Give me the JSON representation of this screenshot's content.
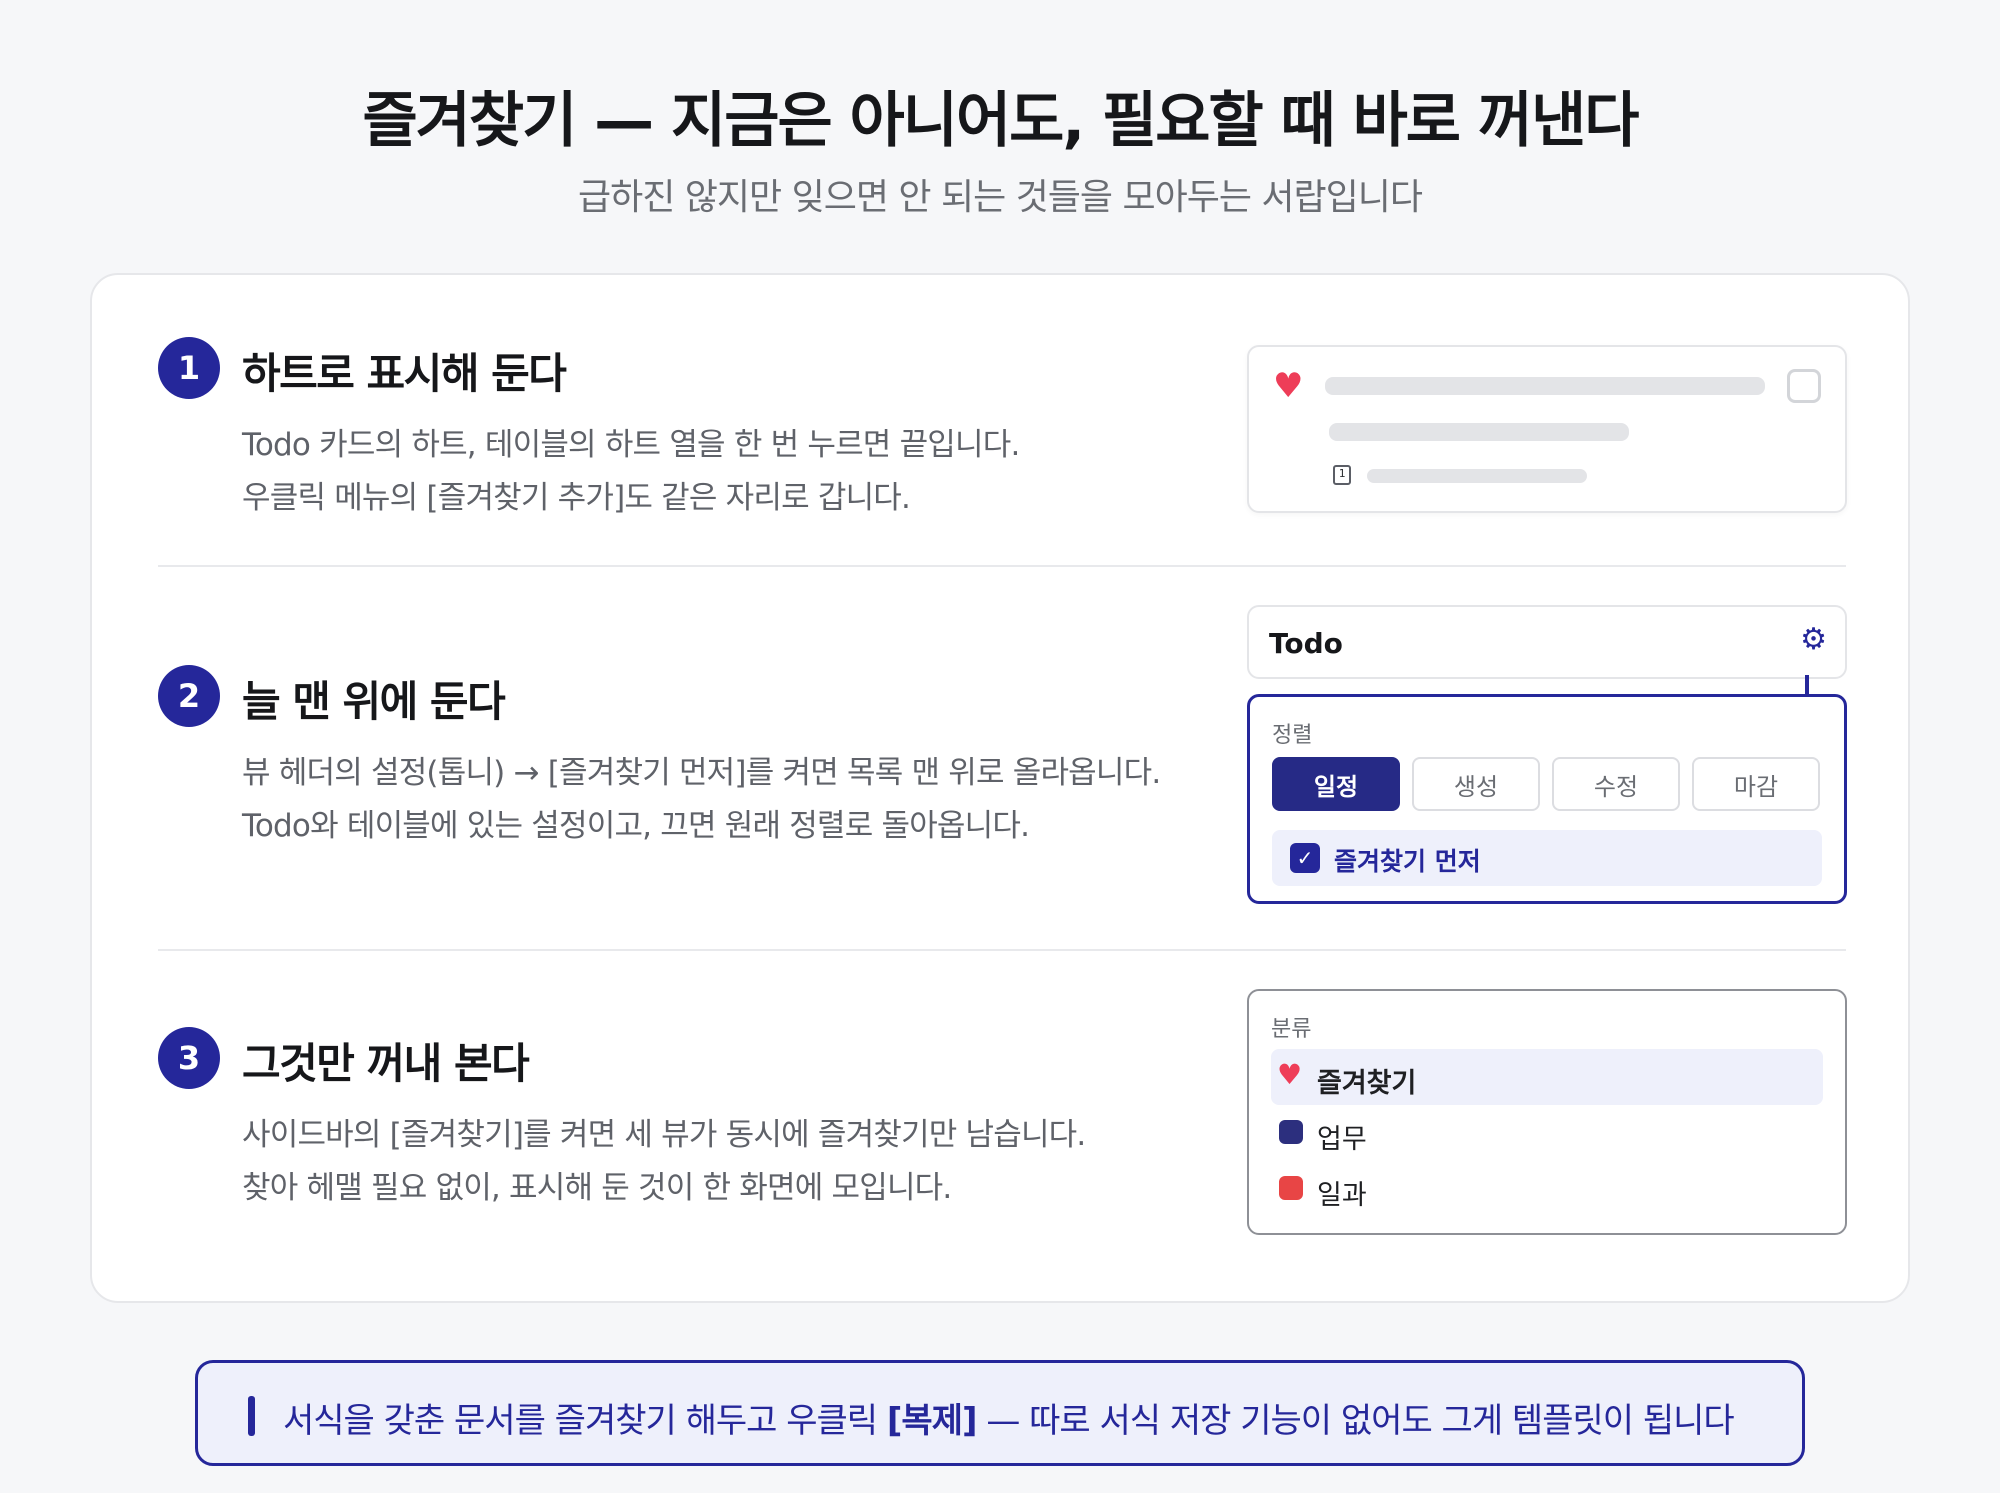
{
  "header": {
    "title": "즐겨찾기 — 지금은 아니어도, 필요할 때 바로 꺼낸다",
    "subtitle": "급하진 않지만 잊으면 안 되는 것들을 모아두는 서랍입니다"
  },
  "steps": [
    {
      "number": "1",
      "heading": "하트로 표시해 둔다",
      "lines": [
        "Todo 카드의 하트, 테이블의 하트 열을 한 번 누르면 끝입니다.",
        "우클릭 메뉴의 [즐겨찾기 추가]도 같은 자리로 갑니다."
      ]
    },
    {
      "number": "2",
      "heading": "늘 맨 위에 둔다",
      "lines": [
        "뷰 헤더의 설정(톱니) → [즐겨찾기 먼저]를 켜면 목록 맨 위로 올라옵니다.",
        "Todo와 테이블에 있는 설정이고, 끄면 원래 정렬로 돌아옵니다."
      ]
    },
    {
      "number": "3",
      "heading": "그것만 꺼내 본다",
      "lines": [
        "사이드바의 [즐겨찾기]를 켜면 세 뷰가 동시에 즐겨찾기만 남습니다.",
        "찾아 헤맬 필요 없이, 표시해 둔 것이 한 화면에 모입니다."
      ]
    }
  ],
  "mock1": {
    "heart_icon": "heart-icon",
    "calendar_icon_text": "1"
  },
  "mock2": {
    "view_title": "Todo",
    "gear_icon": "gear-icon",
    "sort_label": "정렬",
    "sort_options": [
      "일정",
      "생성",
      "수정",
      "마감"
    ],
    "active_sort": "일정",
    "favorites_first_label": "즐겨찾기 먼저",
    "favorites_first_checked": true
  },
  "mock3": {
    "category_label": "분류",
    "items": [
      {
        "label": "즐겨찾기",
        "icon": "heart-icon",
        "color": "#ee3d58",
        "selected": true
      },
      {
        "label": "업무",
        "icon": "square",
        "color": "#2c2f7e",
        "selected": false
      },
      {
        "label": "일과",
        "icon": "square",
        "color": "#e84545",
        "selected": false
      }
    ]
  },
  "tip": {
    "before": "서식을 갖춘 문서를 즐겨찾기 해두고 우클릭 ",
    "bold": "[복제]",
    "after": " — 따로 서식 저장 기능이 없어도 그게 템플릿이 됩니다"
  },
  "colors": {
    "accent": "#25279a",
    "heart": "#ee3d58",
    "background": "#f6f7f9"
  }
}
